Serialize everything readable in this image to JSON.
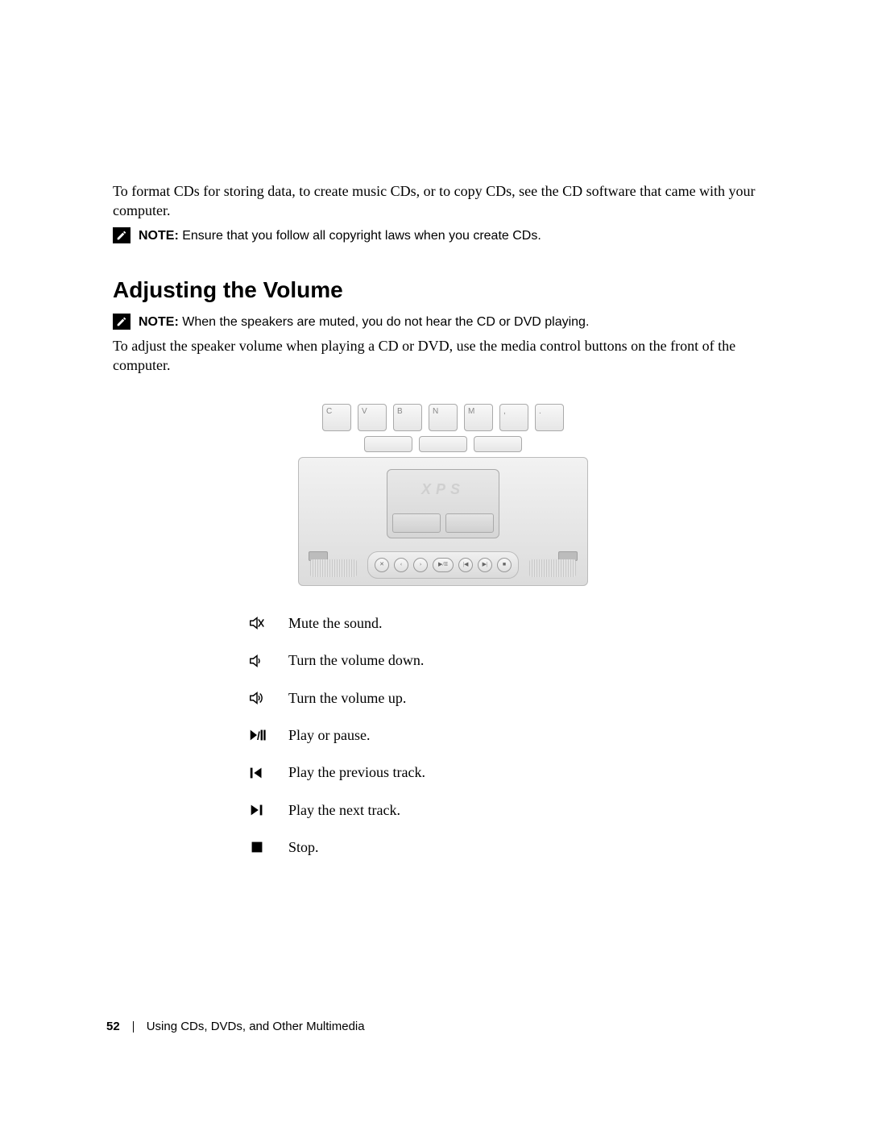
{
  "intro_text": "To format CDs for storing data, to create music CDs, or to copy CDs, see the CD software that came with your computer.",
  "note1": {
    "label": "NOTE:",
    "text": "Ensure that you follow all copyright laws when you create CDs."
  },
  "heading": "Adjusting the Volume",
  "note2": {
    "label": "NOTE:",
    "text": "When the speakers are muted, you do not hear the CD or DVD playing."
  },
  "body2": "To adjust the speaker volume when playing a CD or DVD, use the media control buttons on the front of the computer.",
  "laptop": {
    "brand": "XPS",
    "keys_row1": [
      "C",
      "V",
      "B",
      "N",
      "M",
      ",",
      "."
    ],
    "keys_row2_count": 3,
    "media_buttons": [
      "mute",
      "vol-down",
      "vol-up",
      "play-pause",
      "prev",
      "next",
      "stop"
    ]
  },
  "controls": [
    {
      "icon": "mute-icon",
      "text": "Mute the sound."
    },
    {
      "icon": "volume-down-icon",
      "text": "Turn the volume down."
    },
    {
      "icon": "volume-up-icon",
      "text": "Turn the volume up."
    },
    {
      "icon": "play-pause-icon",
      "text": "Play or pause."
    },
    {
      "icon": "prev-track-icon",
      "text": "Play the previous track."
    },
    {
      "icon": "next-track-icon",
      "text": "Play the next track."
    },
    {
      "icon": "stop-icon",
      "text": "Stop."
    }
  ],
  "footer": {
    "page_number": "52",
    "section": "Using CDs, DVDs, and Other Multimedia"
  }
}
